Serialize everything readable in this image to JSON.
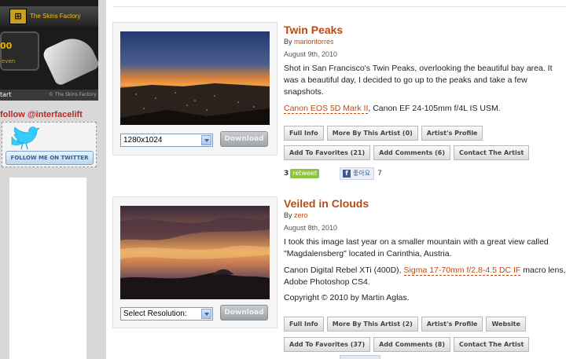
{
  "sidebar": {
    "ad": {
      "brand": "The Skins Factory",
      "score": "00",
      "even_label": "even",
      "start_label": "tart",
      "footer_brand": "© The Skins Factory"
    },
    "follow_text": "follow @interfacelift",
    "twitter_button": "FOLLOW ME ON TWITTER"
  },
  "wallpapers": [
    {
      "title": "Twin Peaks",
      "by": "By ",
      "author": "mariontorres",
      "date": "August 9th, 2010",
      "description": "Shot in San Francisco's Twin Peaks, overlooking the beautiful bay area. It was a beautiful day, I decided to go up to the peaks and take a few snapshots.",
      "gear_link": "Canon EOS 5D Mark II",
      "gear_rest": ", Canon EF 24-105mm f/4L IS USM.",
      "resolution": "1280x1024",
      "download": "Download",
      "buttons_row1": [
        "Full Info",
        "More By This Artist (0)",
        "Artist's Profile"
      ],
      "buttons_row2": [
        "Add To Favorites (21)",
        "Add Comments (6)",
        "Contact The Artist"
      ],
      "retweet_count": "3",
      "retweet_label": "retweet",
      "like_label": "좋아요",
      "like_count": "7"
    },
    {
      "title": "Veiled in Clouds",
      "by": "By ",
      "author": "zero",
      "date": "August 8th, 2010",
      "description": "I took this image last year on a smaller mountain with a great view called \"Magdalensberg\" located in Carinthia, Austria.",
      "gear_pre": "Canon Digital Rebel XTi (400D), ",
      "gear_link": "Sigma 17-70mm f/2.8-4.5 DC IF",
      "gear_rest": " macro lens, Adobe Photoshop CS4.",
      "copyright": "Copyright © 2010 by Martin Aglas.",
      "resolution": "Select Resolution:",
      "download": "Download",
      "buttons_row1": [
        "Full Info",
        "More By This Artist (2)",
        "Artist's Profile",
        "Website"
      ],
      "buttons_row2": [
        "Add To Favorites (37)",
        "Add Comments (8)",
        "Contact The Artist"
      ]
    }
  ],
  "colors": {
    "accent": "#b94a14",
    "sidebar_bg": "#d8d8d8",
    "follow": "#b8282a",
    "retweet": "#8cc63f",
    "facebook": "#3b5998"
  },
  "icons": [
    "skins-factory-logo-icon",
    "twitter-bird-icon",
    "select-arrow-icon",
    "facebook-f-icon"
  ]
}
